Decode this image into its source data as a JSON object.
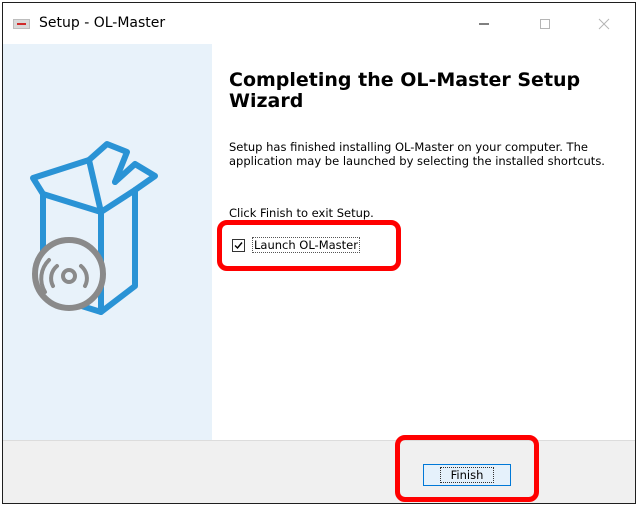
{
  "window": {
    "title": "Setup - OL-Master",
    "controls": {
      "minimize": "—",
      "maximize": "☐",
      "close": "✕"
    }
  },
  "icons": {
    "app": "setup-app-icon",
    "side": "box-with-disc-icon"
  },
  "colors": {
    "side_panel": "#e8f2fa",
    "highlight": "#ff0000",
    "button_border": "#0078d7",
    "icon_stroke": "#2a93d5"
  },
  "main": {
    "heading": "Completing the OL-Master Setup Wizard",
    "body": "Setup has finished installing OL-Master on your computer. The application may be launched by selecting the installed shortcuts.",
    "finish_hint": "Click Finish to exit Setup.",
    "launch_checkbox": {
      "label": "Launch OL-Master",
      "checked": true
    }
  },
  "footer": {
    "finish_label": "Finish"
  }
}
